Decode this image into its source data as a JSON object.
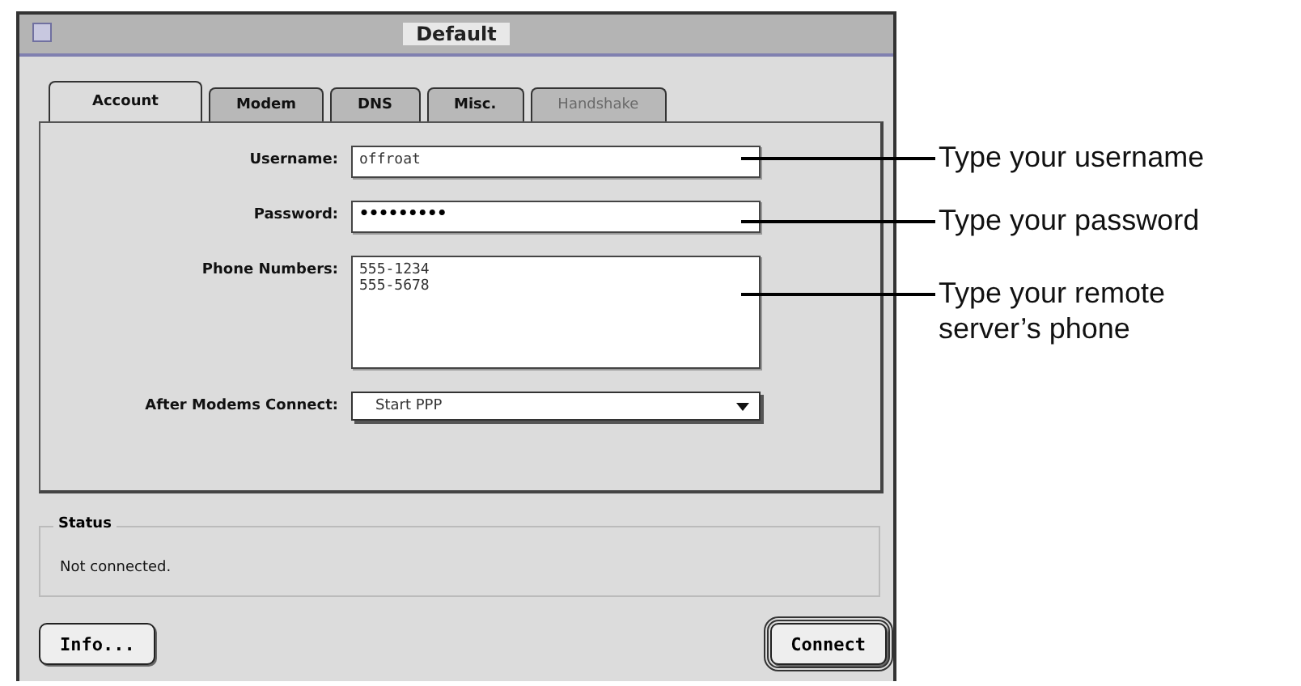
{
  "window": {
    "title": "Default"
  },
  "tabs": [
    {
      "label": "Account",
      "selected": true,
      "disabled": false
    },
    {
      "label": "Modem",
      "selected": false,
      "disabled": false
    },
    {
      "label": "DNS",
      "selected": false,
      "disabled": false
    },
    {
      "label": "Misc.",
      "selected": false,
      "disabled": false
    },
    {
      "label": "Handshake",
      "selected": false,
      "disabled": true
    }
  ],
  "fields": [
    {
      "kind": "text",
      "label": "Username:",
      "value": "offroat"
    },
    {
      "kind": "password",
      "label": "Password:",
      "value": "•••••••••"
    },
    {
      "kind": "multiline",
      "label": "Phone Numbers:",
      "lines": [
        "555-1234",
        "555-5678"
      ]
    },
    {
      "kind": "popup",
      "label": "After Modems Connect:",
      "value": "Start PPP"
    }
  ],
  "status": {
    "title": "Status",
    "text": "Not connected."
  },
  "buttons": [
    {
      "label": "Info...",
      "default": false
    },
    {
      "label": "Connect",
      "default": true
    }
  ],
  "callouts": [
    {
      "text": "Type your username"
    },
    {
      "text": "Type your password"
    },
    {
      "text": "Type your remote server’s phone"
    }
  ]
}
